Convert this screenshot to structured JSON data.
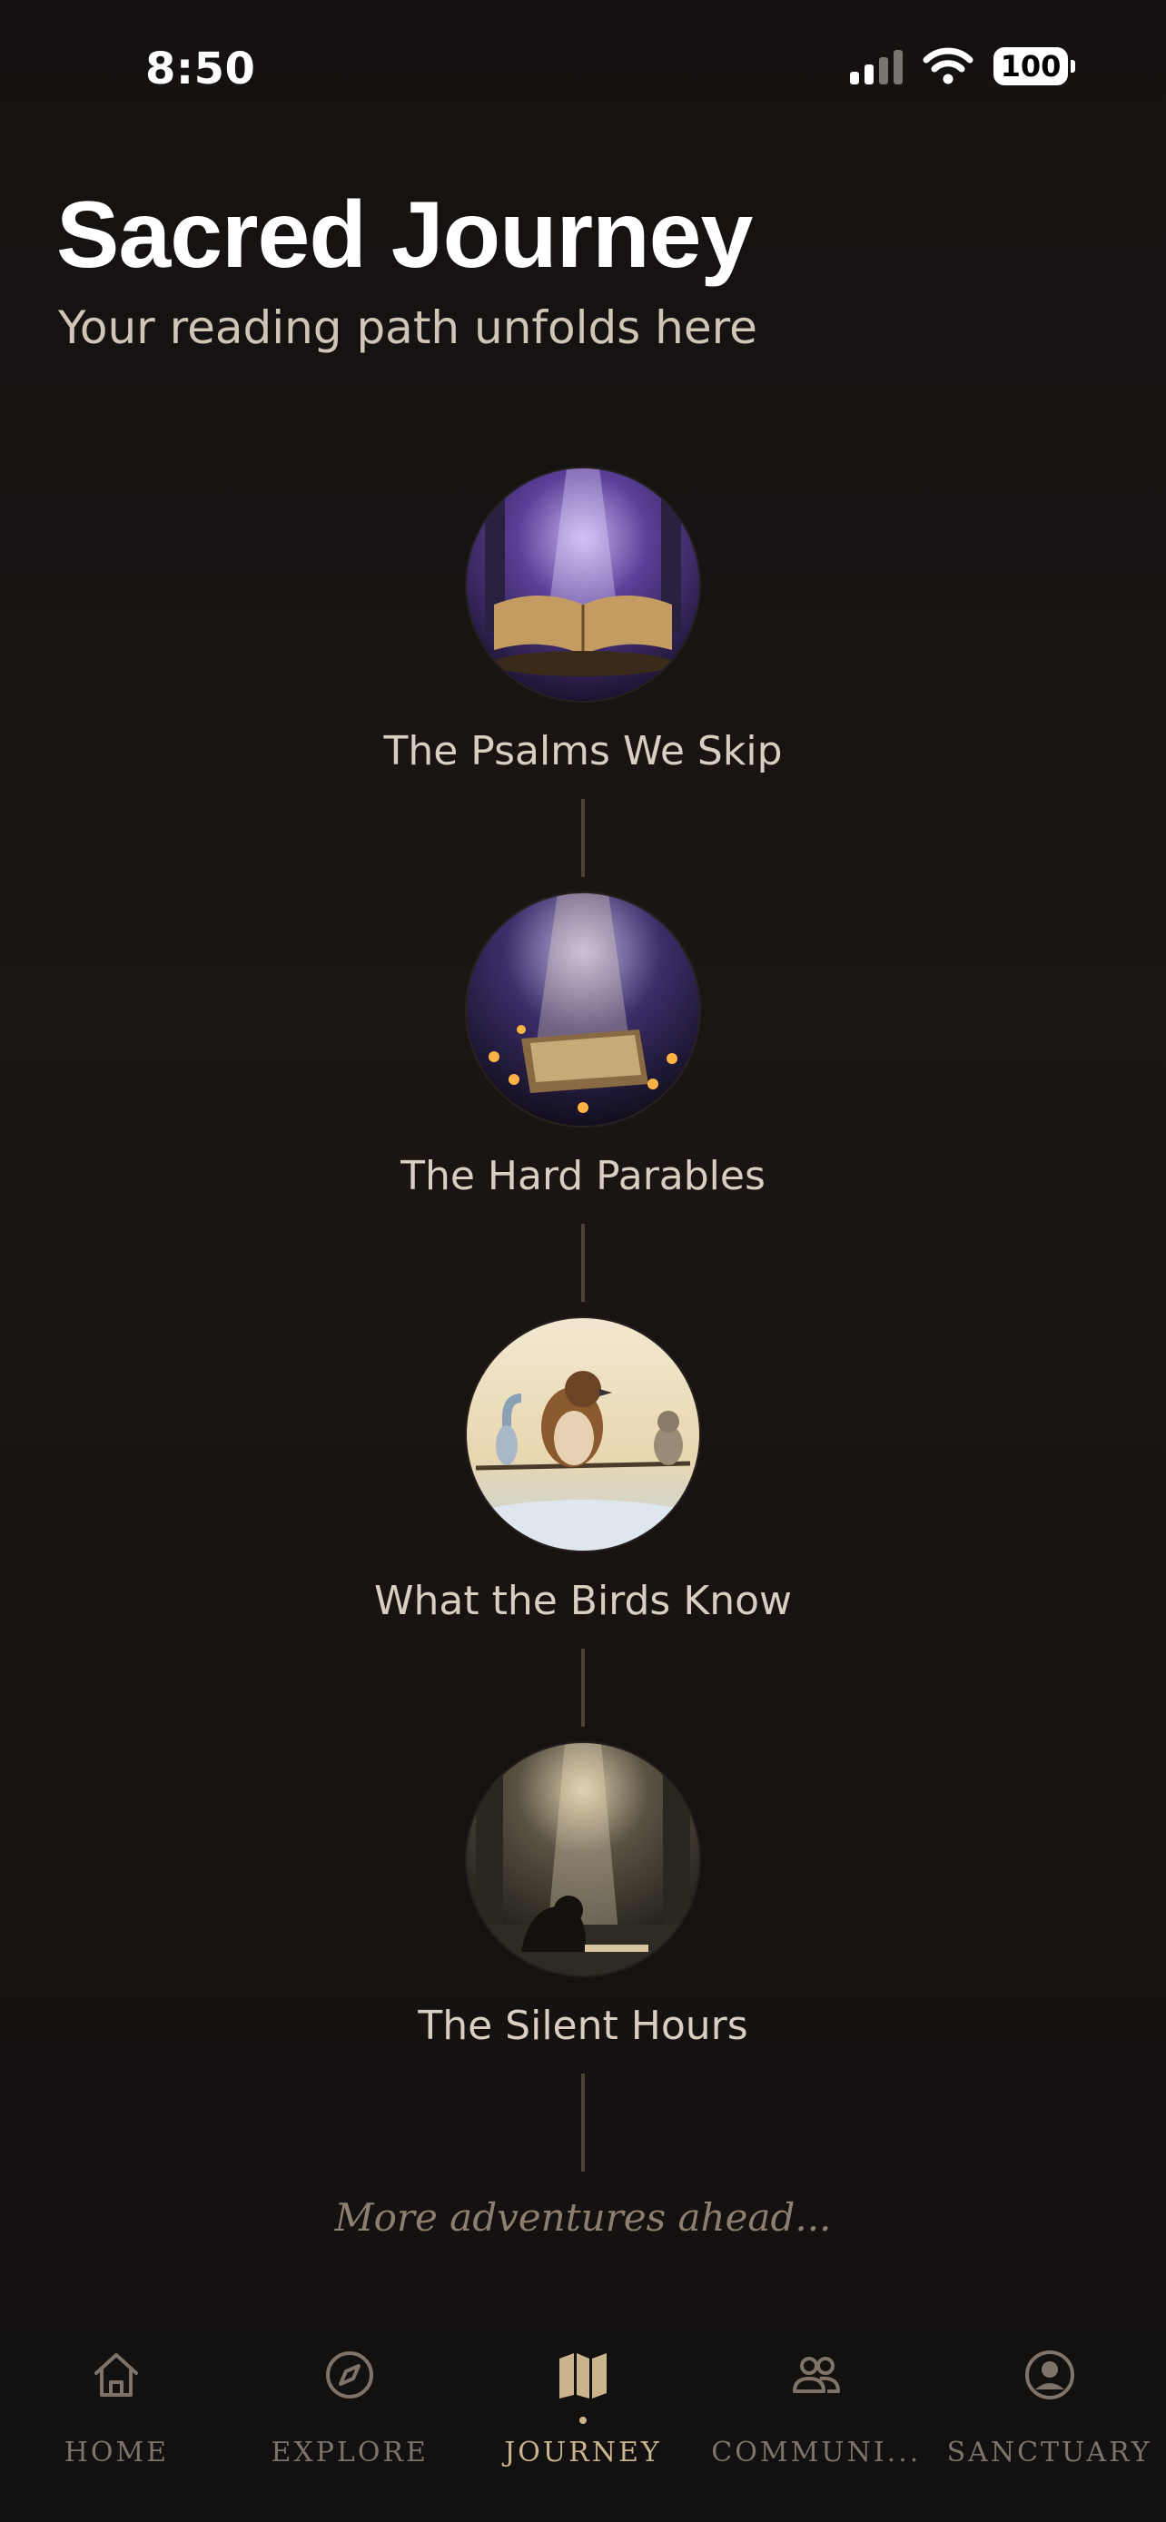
{
  "status_bar": {
    "time": "8:50",
    "battery": "100"
  },
  "header": {
    "title": "Sacred Journey",
    "subtitle": "Your reading path unfolds here"
  },
  "journey": {
    "nodes": [
      {
        "title": "The Psalms We Skip",
        "icon": "open-book-light-image"
      },
      {
        "title": "The Hard Parables",
        "icon": "candlelit-book-image"
      },
      {
        "title": "What the Birds Know",
        "icon": "birds-on-branch-image"
      },
      {
        "title": "The Silent Hours",
        "icon": "kneeling-prayer-image"
      }
    ],
    "more_text": "More adventures ahead..."
  },
  "tab_bar": {
    "tabs": [
      {
        "label": "HOME",
        "icon": "home-icon"
      },
      {
        "label": "EXPLORE",
        "icon": "compass-icon"
      },
      {
        "label": "JOURNEY",
        "icon": "map-icon",
        "active": true
      },
      {
        "label": "COMMUNI...",
        "icon": "people-icon"
      },
      {
        "label": "SANCTUARY",
        "icon": "profile-icon"
      }
    ]
  },
  "colors": {
    "accent": "#c9b48d",
    "background": "#171210",
    "muted_text": "#7d7368"
  }
}
